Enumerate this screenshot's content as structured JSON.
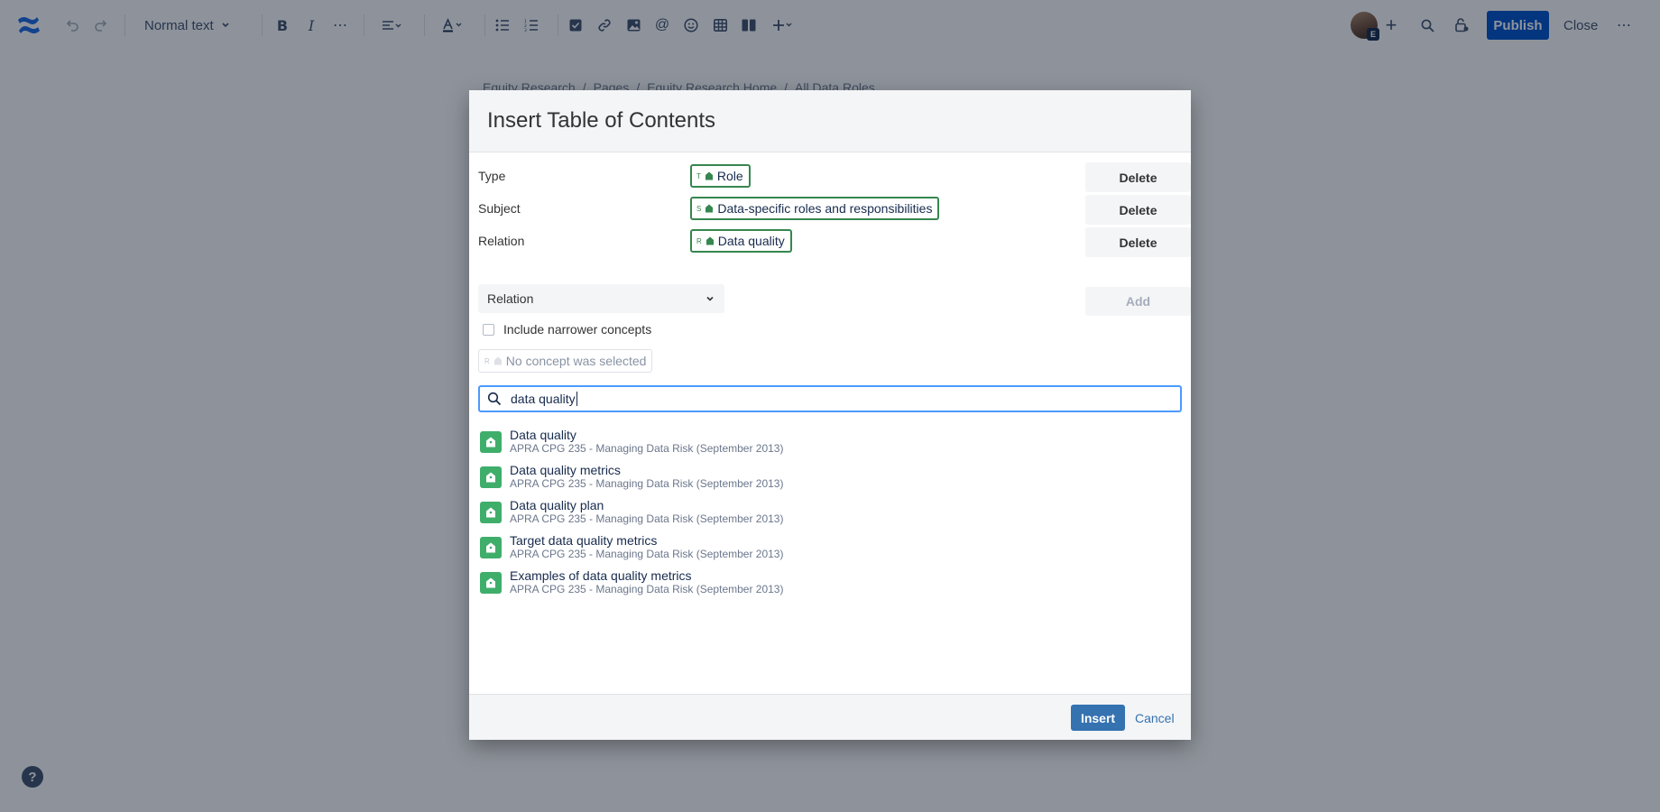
{
  "toolbar": {
    "text_style": "Normal text",
    "publish_label": "Publish",
    "close_label": "Close"
  },
  "breadcrumb": [
    "Equity Research",
    "Pages",
    "Equity Research Home",
    "All Data Roles"
  ],
  "dialog": {
    "title": "Insert Table of Contents",
    "filters": [
      {
        "label": "Type",
        "chip_letter": "T",
        "value": "Role",
        "delete_label": "Delete"
      },
      {
        "label": "Subject",
        "chip_letter": "S",
        "value": "Data-specific roles and responsibilities",
        "delete_label": "Delete"
      },
      {
        "label": "Relation",
        "chip_letter": "R",
        "value": "Data quality",
        "delete_label": "Delete"
      }
    ],
    "relation_select": "Relation",
    "add_label": "Add",
    "include_narrower": "Include narrower concepts",
    "no_concept": "No concept was selected",
    "no_concept_letter": "R",
    "search": {
      "value": "data quality"
    },
    "results": [
      {
        "title": "Data quality",
        "source": "APRA CPG 235 - Managing Data Risk (September 2013)"
      },
      {
        "title": "Data quality metrics",
        "source": "APRA CPG 235 - Managing Data Risk (September 2013)"
      },
      {
        "title": "Data quality plan",
        "source": "APRA CPG 235 - Managing Data Risk (September 2013)"
      },
      {
        "title": "Target data quality metrics",
        "source": "APRA CPG 235 - Managing Data Risk (September 2013)"
      },
      {
        "title": "Examples of data quality metrics",
        "source": "APRA CPG 235 - Managing Data Risk (September 2013)"
      }
    ],
    "insert_label": "Insert",
    "cancel_label": "Cancel"
  },
  "help_label": "?",
  "avatar_badge": "E",
  "colors": {
    "accent": "#0052cc",
    "chip_border": "#36874f",
    "result_icon": "#3fae6b",
    "insert_button": "#3572b0",
    "overlay": "rgba(9,20,38,0.46)"
  }
}
